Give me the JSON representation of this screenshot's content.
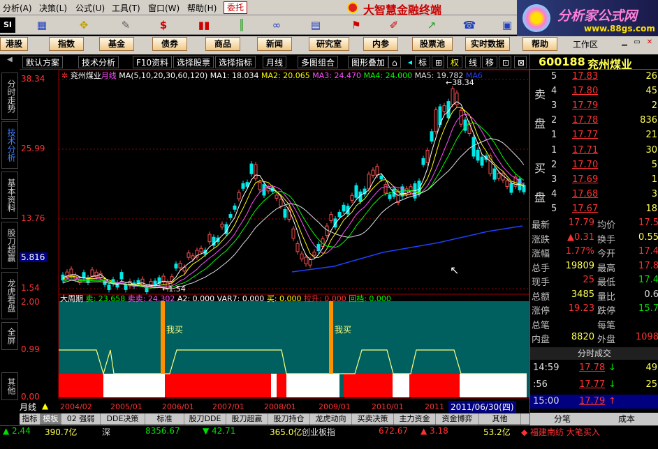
{
  "menu": [
    "分析(A)",
    "决策(L)",
    "公式(U)",
    "工具(T)",
    "窗口(W)",
    "帮助(H)"
  ],
  "wt_button": "委托",
  "app_title": "大智慧金融终端",
  "banner": {
    "title": "分析家公式网",
    "url": "www.88gs.com"
  },
  "toolbar_label": "SI",
  "nav": [
    "港股",
    "指数",
    "基金",
    "债券",
    "商品",
    "新闻",
    "研究室",
    "内参",
    "股票池",
    "实时数据",
    "帮助"
  ],
  "workspace": "工作区",
  "sidetabs": [
    "分时走势",
    "技术分析",
    "基本资料",
    "股刀超赢",
    "龙虎看盘",
    "全屏",
    "其他"
  ],
  "chart_toolbar": [
    "默认方案",
    "技术分析",
    "F10资料",
    "选择股票",
    "选择指标",
    "月线",
    "多图组合",
    "图形叠加"
  ],
  "chart_toolbar_icons": [
    "标",
    "权",
    "线",
    "移"
  ],
  "main": {
    "stock_name": "兖州煤业",
    "period": "月线",
    "ma_params": "MA(5,10,20,30,60,120)",
    "ma_labels": [
      "MA1: 18.034",
      "MA2: 20.065",
      "MA3: 24.470",
      "MA4: 24.000",
      "MA5: 19.782",
      "MA6"
    ],
    "ma_colors": [
      "#ffffff",
      "#ffff00",
      "#ff50ff",
      "#00ff00",
      "#e0e0e0",
      "#2040ff"
    ],
    "axis": [
      "38.34",
      "25.99",
      "13.76",
      "1.54"
    ],
    "axis_cursor": "5.816",
    "high_label": "38.34",
    "low_label": "1.54"
  },
  "sub": {
    "title": "大周期",
    "indicators": [
      "卖: 23.658",
      "卖卖: 24.302",
      "A2: 0.000",
      "VAR7: 0.000",
      "买: 0.000",
      "拉升: 0.000",
      "回档: 0.000"
    ],
    "axis": [
      "2.00",
      "0.99",
      "0.00"
    ],
    "signals": [
      "我买",
      "我买"
    ]
  },
  "timeline": {
    "label": "月线",
    "years": [
      "2004/02",
      "2005/01",
      "2006/01",
      "2007/01",
      "2008/01",
      "2009/01",
      "2010/01",
      "2011"
    ],
    "cursor": "2011/06/30(四)"
  },
  "bottom_tabs": [
    "指标",
    "模板",
    "02 强弱",
    "DDE决策",
    "标准",
    "股刀DDE",
    "股刀超赢",
    "股刀持仓",
    "龙虎动向",
    "买卖决策",
    "主力资金",
    "资金博弈",
    "其他"
  ],
  "ticker": {
    "items": [
      "▲ 2.44",
      "390.7亿",
      "深",
      "8356.67",
      "▼ 42.71",
      "365.0亿",
      "创业板指",
      "672.67",
      "▲ 3.18",
      "53.2亿",
      "◆ 福建南纺 大笔买入"
    ]
  },
  "quote": {
    "code": "600188",
    "name": "兖州煤业",
    "sell_label": [
      "卖",
      "盘"
    ],
    "buy_label": [
      "买",
      "盘"
    ],
    "sell": [
      {
        "n": "5",
        "p": "17.83",
        "v": "26"
      },
      {
        "n": "4",
        "p": "17.80",
        "v": "45"
      },
      {
        "n": "3",
        "p": "17.79",
        "v": "2"
      },
      {
        "n": "2",
        "p": "17.78",
        "v": "836"
      },
      {
        "n": "1",
        "p": "17.77",
        "v": "21"
      }
    ],
    "buy": [
      {
        "n": "1",
        "p": "17.71",
        "v": "30"
      },
      {
        "n": "2",
        "p": "17.70",
        "v": "5"
      },
      {
        "n": "3",
        "p": "17.69",
        "v": "1"
      },
      {
        "n": "4",
        "p": "17.68",
        "v": "3"
      },
      {
        "n": "5",
        "p": "17.67",
        "v": "18"
      }
    ],
    "stats": [
      {
        "l1": "最新",
        "v1": "17.79",
        "l2": "均价",
        "v2": "17.5"
      },
      {
        "l1": "涨跌",
        "v1": "▲0.31",
        "l2": "换手",
        "v2": "0.55"
      },
      {
        "l1": "涨幅",
        "v1": "1.77%",
        "l2": "今开",
        "v2": "17.4"
      },
      {
        "l1": "总手",
        "v1": "19809",
        "l2": "最高",
        "v2": "17.8"
      },
      {
        "l1": "现手",
        "v1": "25",
        "l2": "最低",
        "v2": "17.4"
      },
      {
        "l1": "总额",
        "v1": "3485",
        "l2": "量比",
        "v2": "0.6"
      },
      {
        "l1": "涨停",
        "v1": "19.23",
        "l2": "跌停",
        "v2": "15.7"
      },
      {
        "l1": "总笔",
        "v1": "",
        "l2": "每笔",
        "v2": ""
      },
      {
        "l1": "内盘",
        "v1": "8820",
        "l2": "外盘",
        "v2": "1098"
      }
    ],
    "trades_title": "分时成交",
    "trades": [
      {
        "t": "14:59",
        "p": "17.78",
        "v": "49",
        "dir": "down"
      },
      {
        "t": ":56",
        "p": "17.77",
        "v": "25",
        "dir": "down"
      },
      {
        "t": "15:00",
        "p": "17.79",
        "v": "",
        "dir": "up"
      }
    ],
    "tabs": [
      "分笔",
      "成本"
    ]
  }
}
